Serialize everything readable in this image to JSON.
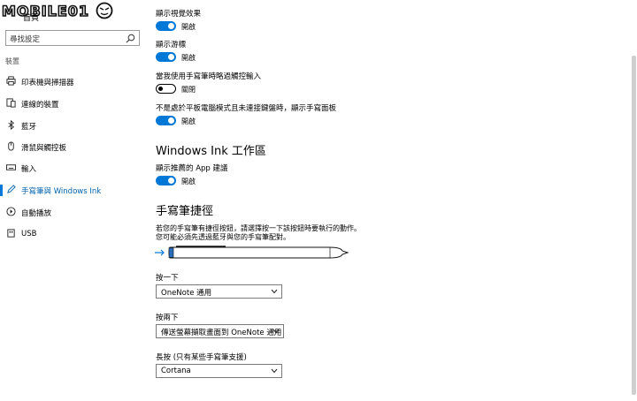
{
  "logo": {
    "text": "MOBILE01"
  },
  "sidebar": {
    "home_label": "首頁",
    "search_placeholder": "尋找設定",
    "section_title": "裝置",
    "items": [
      {
        "label": "印表機與掃描器",
        "icon": "printer-icon"
      },
      {
        "label": "連線的裝置",
        "icon": "connected-devices-icon"
      },
      {
        "label": "藍牙",
        "icon": "bluetooth-icon"
      },
      {
        "label": "滑鼠與觸控板",
        "icon": "mouse-icon"
      },
      {
        "label": "輸入",
        "icon": "keyboard-icon"
      },
      {
        "label": "手寫筆與 Windows Ink",
        "icon": "pen-icon",
        "active": true
      },
      {
        "label": "自動播放",
        "icon": "autoplay-icon"
      },
      {
        "label": "USB",
        "icon": "usb-icon"
      }
    ]
  },
  "main": {
    "options": [
      {
        "label": "顯示視覺效果",
        "state": "開啟",
        "on": true
      },
      {
        "label": "顯示游標",
        "state": "開啟",
        "on": true
      },
      {
        "label": "當我使用手寫筆時略過觸控輸入",
        "state": "關閉",
        "on": false
      },
      {
        "label": "不是處於平板電腦模式且未連接鍵盤時，顯示手寫面板",
        "state": "開啟",
        "on": true
      }
    ],
    "ink_heading": "Windows Ink 工作區",
    "ink_option": {
      "label": "顯示推薦的 App 建議",
      "state": "開啟",
      "on": true
    },
    "shortcut_heading": "手寫筆捷徑",
    "shortcut_desc_line1": "若您的手寫筆有捷徑按鈕，請選擇按一下該按鈕時要執行的動作。",
    "shortcut_desc_line2": "您可能必須先透過藍牙與您的手寫筆配對。",
    "dropdowns": [
      {
        "label": "按一下",
        "value": "OneNote 通用"
      },
      {
        "label": "按兩下",
        "value": "傳送螢幕擷取畫面到 OneNote 通用"
      },
      {
        "label": "長按 (只有某些手寫筆支援)",
        "value": "Cortana"
      }
    ]
  },
  "colors": {
    "accent": "#0078d7",
    "active_text": "#0063b1"
  }
}
